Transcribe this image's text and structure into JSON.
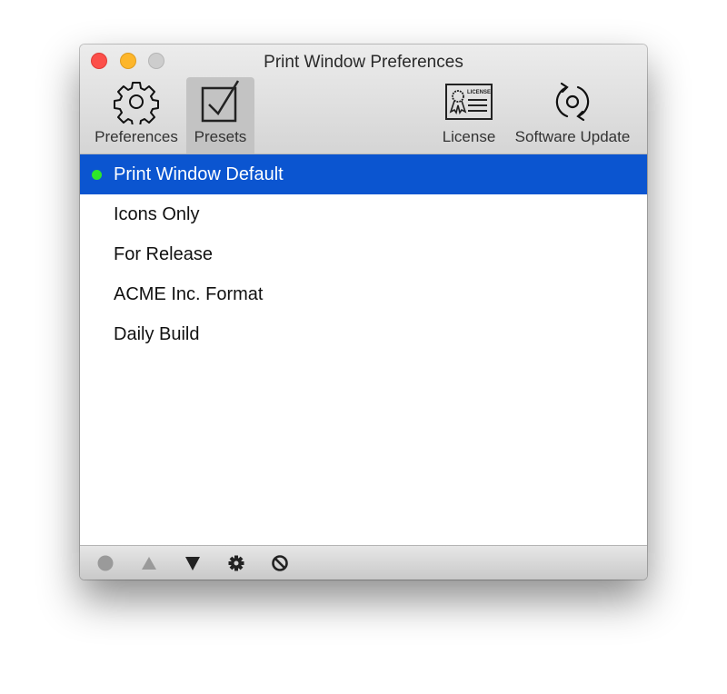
{
  "window": {
    "title": "Print Window Preferences"
  },
  "toolbar": {
    "items": [
      {
        "label": "Preferences",
        "icon": "gear-icon",
        "selected": false
      },
      {
        "label": "Presets",
        "icon": "checkbox-icon",
        "selected": true
      },
      {
        "label": "License",
        "icon": "license-certificate-icon",
        "selected": false
      },
      {
        "label": "Software Update",
        "icon": "refresh-icon",
        "selected": false
      }
    ],
    "license_icon_text": "LICENSE"
  },
  "presets": {
    "items": [
      {
        "label": "Print Window Default",
        "selected": true,
        "active_indicator": true
      },
      {
        "label": "Icons Only",
        "selected": false
      },
      {
        "label": "For Release",
        "selected": false
      },
      {
        "label": "ACME Inc. Format",
        "selected": false
      },
      {
        "label": "Daily Build",
        "selected": false
      }
    ]
  },
  "footer": {
    "buttons": [
      {
        "name": "set-default-button",
        "icon": "circle-icon",
        "enabled": false
      },
      {
        "name": "move-up-button",
        "icon": "triangle-up-icon",
        "enabled": false
      },
      {
        "name": "move-down-button",
        "icon": "triangle-down-icon",
        "enabled": true
      },
      {
        "name": "action-button",
        "icon": "gear-icon",
        "enabled": true
      },
      {
        "name": "delete-button",
        "icon": "prohibited-icon",
        "enabled": true
      }
    ]
  },
  "colors": {
    "selection": "#0b55d0",
    "active_dot": "#2ee62a",
    "close": "#fc4f4a",
    "minimize": "#fdb62b",
    "zoom_disabled": "#cdcdcd"
  }
}
